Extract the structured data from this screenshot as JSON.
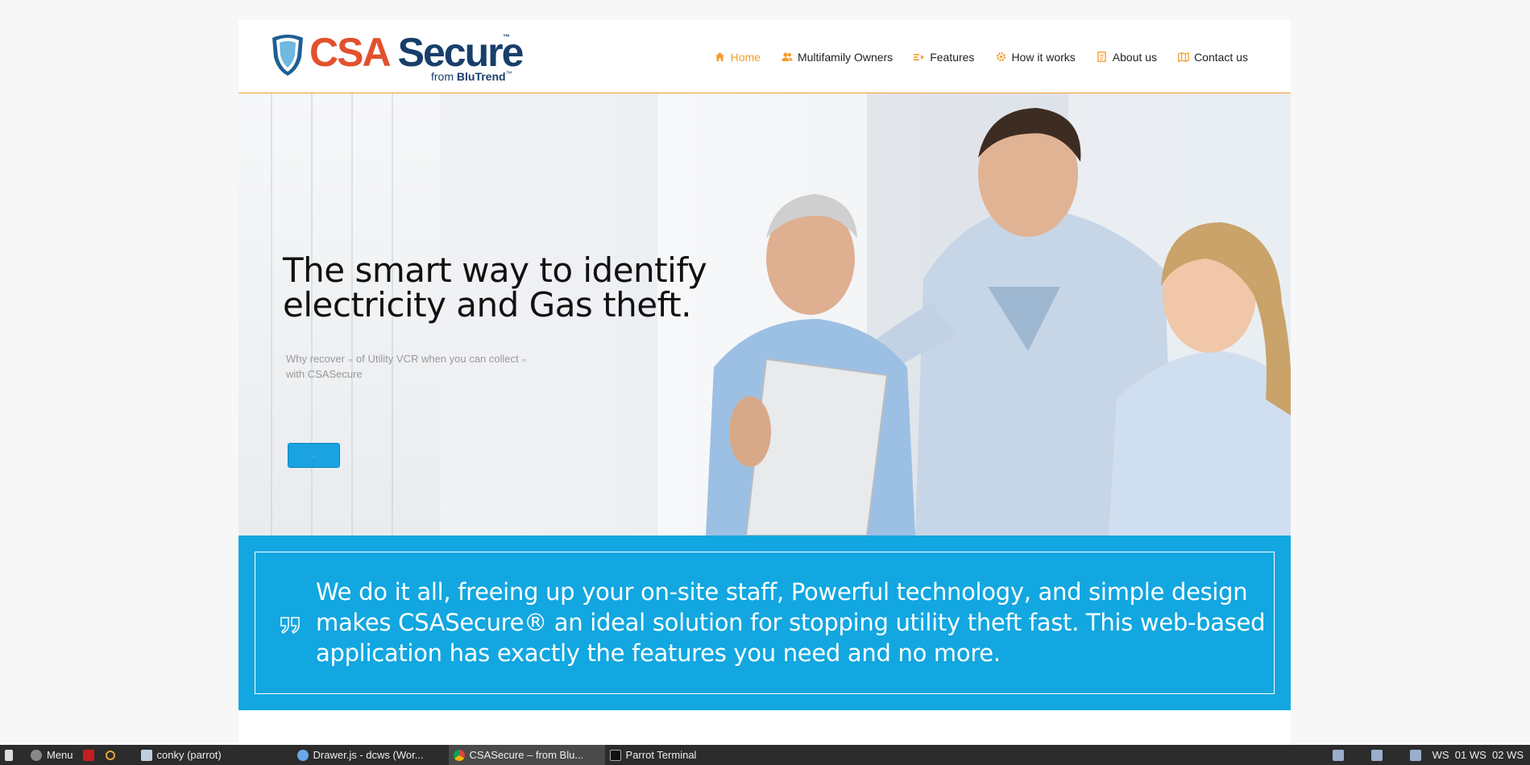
{
  "brand": {
    "name_part1": "CSA",
    "name_part2": " Secure",
    "tm": "™",
    "from": "from ",
    "company": "BluTrend",
    "company_tm": "™"
  },
  "nav": {
    "items": [
      {
        "label": "Home",
        "icon": "home-icon"
      },
      {
        "label": "Multifamily Owners",
        "icon": "users-icon"
      },
      {
        "label": "Features",
        "icon": "features-icon"
      },
      {
        "label": "How it works",
        "icon": "gear-icon"
      },
      {
        "label": "About us",
        "icon": "document-icon"
      },
      {
        "label": "Contact us",
        "icon": "map-icon"
      }
    ],
    "active_index": 0
  },
  "hero": {
    "title": "The smart way to identify electricity and Gas theft.",
    "subtitle": "Why recover ₌ of Utility VCR when you can collect ₌ with CSASecure",
    "button_label": "·"
  },
  "band": {
    "quote": "We do it all, freeing up your on-site staff, Powerful technology, and simple design makes CSASecure® an ideal solution for stopping utility theft fast. This web-based application has exactly the features you need and no more."
  },
  "taskbar": {
    "menu_label": "Menu",
    "windows": [
      {
        "label": "conky (parrot)",
        "active": false
      },
      {
        "label": "Drawer.js - dcws (Wor...",
        "active": false
      },
      {
        "label": "CSASecure – from Blu...",
        "active": true
      },
      {
        "label": "Parrot Terminal",
        "active": false
      }
    ],
    "workspaces": "WS  01 WS  02 WS"
  },
  "colors": {
    "accent_orange": "#f39c2d",
    "brand_blue": "#12a7e0",
    "logo_red": "#e2512d",
    "logo_navy": "#183f6b"
  }
}
